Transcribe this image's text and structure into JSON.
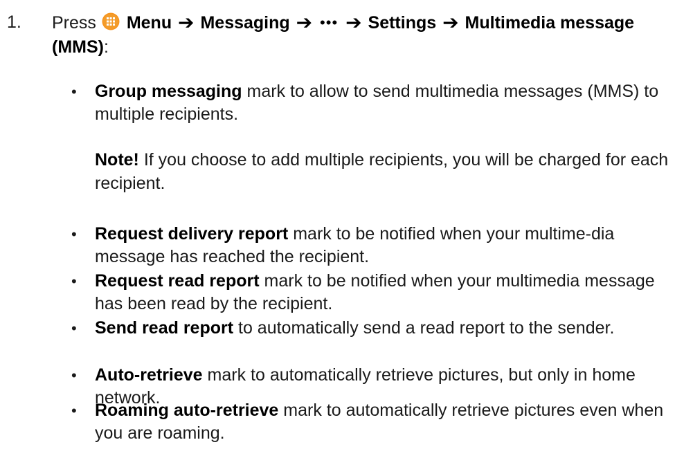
{
  "step": {
    "number": "1.",
    "press": "Press",
    "menu": "Menu",
    "messaging": "Messaging",
    "dots": "•••",
    "settings": "Settings",
    "target": "Multimedia message (MMS)",
    "colon": ":",
    "arrow": "➔",
    "menu_icon_color": "#F7941D"
  },
  "bullets": [
    {
      "term": "Group messaging",
      "text": " mark to allow to send multimedia messages (MMS) to multiple recipients."
    },
    {
      "term": "Request delivery report",
      "text": " mark to be notified when your multime-dia message has reached the recipient."
    },
    {
      "term": "Request read report",
      "text": " mark to be notified when your multimedia message has been read by the recipient."
    },
    {
      "term": "Send read report",
      "text": " to automatically send a read report to the sender."
    },
    {
      "term": "Auto-retrieve",
      "text": " mark to automatically retrieve pictures, but only in home network."
    },
    {
      "term": "Roaming auto-retrieve",
      "text": " mark to automatically retrieve pictures even when you are roaming."
    }
  ],
  "note": {
    "label": "Note!",
    "text": " If you choose to add multiple recipients, you will be charged for each recipient."
  },
  "bullet_symbol": "•"
}
